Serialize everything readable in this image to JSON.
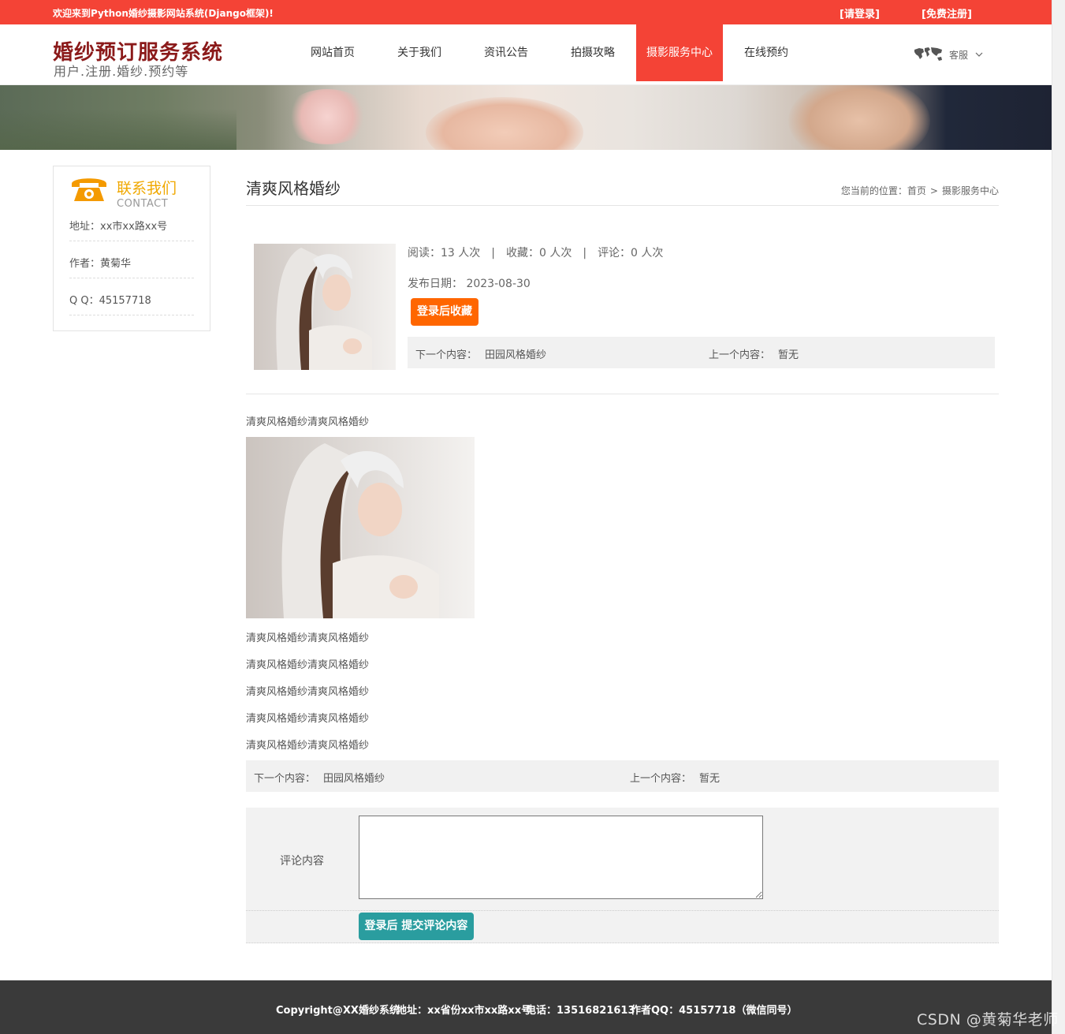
{
  "topbar": {
    "welcome": "欢迎来到Python婚纱摄影网站系统(Django框架)!",
    "login": "[请登录]",
    "register": "[免费注册]"
  },
  "header": {
    "logo_title": "婚纱预订服务系统",
    "logo_sub": "用户.注册.婚纱.预约等",
    "nav": [
      {
        "label": "网站首页"
      },
      {
        "label": "关于我们"
      },
      {
        "label": "资讯公告"
      },
      {
        "label": "拍摄攻略"
      },
      {
        "label": "摄影服务中心"
      },
      {
        "label": "在线预约"
      }
    ],
    "active_nav": "摄影服务中心",
    "service_label": "客服"
  },
  "sidebar": {
    "title": "联系我们",
    "subtitle": "CONTACT",
    "rows": [
      {
        "text": "地址：xx市xx路xx号"
      },
      {
        "text": "作者：黄菊华"
      },
      {
        "text": "Q Q：45157718"
      }
    ]
  },
  "main": {
    "page_title": "清爽风格婚纱",
    "breadcrumb": {
      "prefix": "您当前的位置：",
      "home": "首页",
      "sep": ">",
      "current": "摄影服务中心"
    },
    "meta": {
      "reads": "阅读：13 人次",
      "favs": "收藏：0 人次",
      "comments": "评论：0 人次",
      "bar": "|"
    },
    "date_label": "发布日期：",
    "date_value": "2023-08-30",
    "fav_button": "登录后收藏",
    "next_label": "下一个内容：",
    "next_value": "田园风格婚纱",
    "prev_label": "上一个内容：",
    "prev_value": "暂无",
    "paragraphs": [
      {
        "text": "清爽风格婚纱清爽风格婚纱"
      },
      {
        "text": "清爽风格婚纱清爽风格婚纱"
      },
      {
        "text": "清爽风格婚纱清爽风格婚纱"
      },
      {
        "text": "清爽风格婚纱清爽风格婚纱"
      },
      {
        "text": "清爽风格婚纱清爽风格婚纱"
      },
      {
        "text": "清爽风格婚纱清爽风格婚纱"
      }
    ],
    "comment_label": "评论内容",
    "comment_value": "",
    "submit_button": "登录后 提交评论内容"
  },
  "footer": {
    "copyright": "Copyright@XX婚纱系统",
    "address": "地址：xx省份xx市xx路xx号",
    "phone": "电话：13516821613",
    "qq": "作者QQ：45157718（微信同号）"
  },
  "watermark": "CSDN @黄菊华老师",
  "colors": {
    "primary_red": "#f44336",
    "logo_red": "#8b1a1a",
    "accent_orange": "#ff6600",
    "contact_gold": "#f0a800",
    "submit_teal": "#2a9d9f",
    "footer_bg": "#3a3a3a"
  },
  "icons": {
    "service": "world-map-icon",
    "service_chevron": "chevron-down-icon",
    "contact": "telephone-icon"
  }
}
